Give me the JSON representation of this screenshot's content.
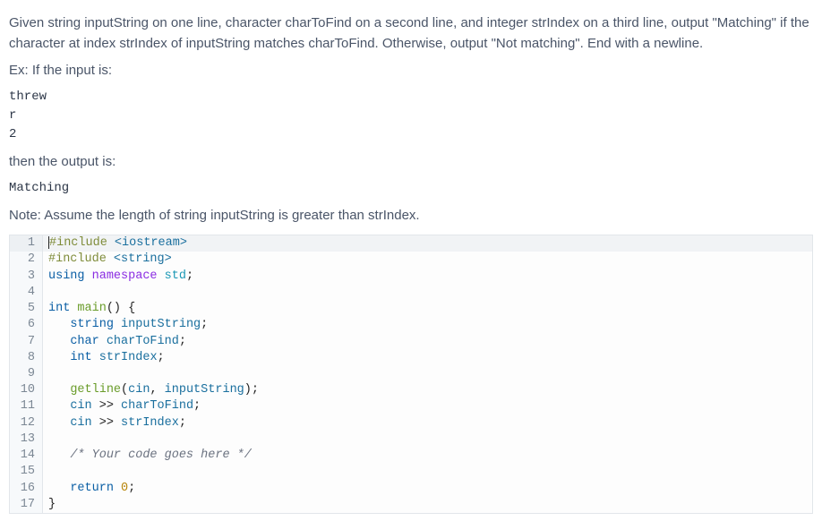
{
  "problem": {
    "description": "Given string inputString on one line, character charToFind on a second line, and integer strIndex on a third line, output \"Matching\" if the character at index strIndex of inputString matches charToFind. Otherwise, output \"Not matching\". End with a newline.",
    "example_label": "Ex: If the input is:",
    "example_input": "threw\nr\n2",
    "then_label": "then the output is:",
    "example_output": "Matching",
    "note": "Note: Assume the length of string inputString is greater than strIndex."
  },
  "code": {
    "lines": [
      {
        "n": 1,
        "hl": true,
        "tokens": [
          [
            "cursor",
            ""
          ],
          [
            "pre",
            "#include "
          ],
          [
            "inc",
            "<iostream>"
          ]
        ]
      },
      {
        "n": 2,
        "hl": false,
        "tokens": [
          [
            "pre",
            "#include "
          ],
          [
            "inc",
            "<string>"
          ]
        ]
      },
      {
        "n": 3,
        "hl": false,
        "tokens": [
          [
            "kw",
            "using"
          ],
          [
            "plain",
            " "
          ],
          [
            "ns",
            "namespace"
          ],
          [
            "plain",
            " "
          ],
          [
            "std",
            "std"
          ],
          [
            "plain",
            ";"
          ]
        ]
      },
      {
        "n": 4,
        "hl": false,
        "tokens": []
      },
      {
        "n": 5,
        "hl": false,
        "tokens": [
          [
            "kw",
            "int"
          ],
          [
            "plain",
            " "
          ],
          [
            "func",
            "main"
          ],
          [
            "plain",
            "() {"
          ]
        ]
      },
      {
        "n": 6,
        "hl": false,
        "tokens": [
          [
            "plain",
            "   "
          ],
          [
            "type",
            "string"
          ],
          [
            "plain",
            " "
          ],
          [
            "id",
            "inputString"
          ],
          [
            "plain",
            ";"
          ]
        ]
      },
      {
        "n": 7,
        "hl": false,
        "tokens": [
          [
            "plain",
            "   "
          ],
          [
            "kw",
            "char"
          ],
          [
            "plain",
            " "
          ],
          [
            "id",
            "charToFind"
          ],
          [
            "plain",
            ";"
          ]
        ]
      },
      {
        "n": 8,
        "hl": false,
        "tokens": [
          [
            "plain",
            "   "
          ],
          [
            "kw",
            "int"
          ],
          [
            "plain",
            " "
          ],
          [
            "id",
            "strIndex"
          ],
          [
            "plain",
            ";"
          ]
        ]
      },
      {
        "n": 9,
        "hl": false,
        "tokens": []
      },
      {
        "n": 10,
        "hl": false,
        "tokens": [
          [
            "plain",
            "   "
          ],
          [
            "func",
            "getline"
          ],
          [
            "plain",
            "("
          ],
          [
            "id",
            "cin"
          ],
          [
            "plain",
            ", "
          ],
          [
            "id",
            "inputString"
          ],
          [
            "plain",
            ");"
          ]
        ]
      },
      {
        "n": 11,
        "hl": false,
        "tokens": [
          [
            "plain",
            "   "
          ],
          [
            "id",
            "cin"
          ],
          [
            "plain",
            " >> "
          ],
          [
            "id",
            "charToFind"
          ],
          [
            "plain",
            ";"
          ]
        ]
      },
      {
        "n": 12,
        "hl": false,
        "tokens": [
          [
            "plain",
            "   "
          ],
          [
            "id",
            "cin"
          ],
          [
            "plain",
            " >> "
          ],
          [
            "id",
            "strIndex"
          ],
          [
            "plain",
            ";"
          ]
        ]
      },
      {
        "n": 13,
        "hl": false,
        "tokens": []
      },
      {
        "n": 14,
        "hl": false,
        "tokens": [
          [
            "plain",
            "   "
          ],
          [
            "comm",
            "/* Your code goes here */"
          ]
        ]
      },
      {
        "n": 15,
        "hl": false,
        "tokens": []
      },
      {
        "n": 16,
        "hl": false,
        "tokens": [
          [
            "plain",
            "   "
          ],
          [
            "kw",
            "return"
          ],
          [
            "plain",
            " "
          ],
          [
            "num",
            "0"
          ],
          [
            "plain",
            ";"
          ]
        ]
      },
      {
        "n": 17,
        "hl": false,
        "tokens": [
          [
            "plain",
            "}"
          ]
        ]
      }
    ]
  }
}
